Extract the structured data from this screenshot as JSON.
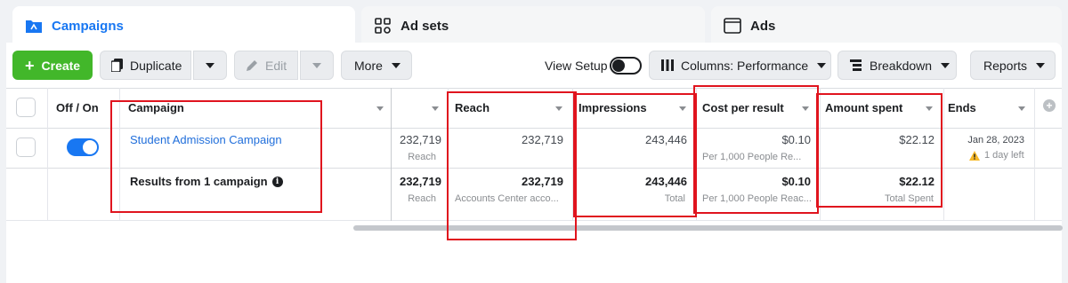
{
  "tabs": [
    {
      "label": "Campaigns",
      "icon": "folder-icon"
    },
    {
      "label": "Ad sets",
      "icon": "grid-icon"
    },
    {
      "label": "Ads",
      "icon": "window-icon"
    }
  ],
  "toolbar": {
    "create_label": "Create",
    "duplicate_label": "Duplicate",
    "edit_label": "Edit",
    "more_label": "More",
    "view_setup_label": "View Setup",
    "columns_label": "Columns: Performance",
    "breakdown_label": "Breakdown",
    "reports_label": "Reports"
  },
  "table": {
    "headers": {
      "off_on": "Off / On",
      "campaign": "Campaign",
      "reach": "Reach",
      "impressions": "Impressions",
      "cost_per_result": "Cost per result",
      "amount_spent": "Amount spent",
      "ends": "Ends"
    },
    "row": {
      "campaign": "Student Admission Campaign",
      "results": "232,719",
      "results_sub": "Reach",
      "reach": "232,719",
      "impressions": "243,446",
      "cost_per_result": "$0.10",
      "cost_per_result_sub": "Per 1,000 People Re...",
      "amount_spent": "$22.12",
      "ends": "Jan 28, 2023",
      "ends_sub": "1 day left"
    },
    "summary": {
      "label": "Results from 1 campaign",
      "results": "232,719",
      "results_sub": "Reach",
      "reach": "232,719",
      "reach_sub": "Accounts Center acco...",
      "impressions": "243,446",
      "impressions_sub": "Total",
      "cost_per_result": "$0.10",
      "cost_per_result_sub": "Per 1,000 People Reac...",
      "amount_spent": "$22.12",
      "amount_spent_sub": "Total Spent"
    }
  },
  "colors": {
    "accent": "#1877f2",
    "create_green": "#42b72a",
    "highlight_red": "#e0141e",
    "warning_yellow": "#f7b928"
  }
}
